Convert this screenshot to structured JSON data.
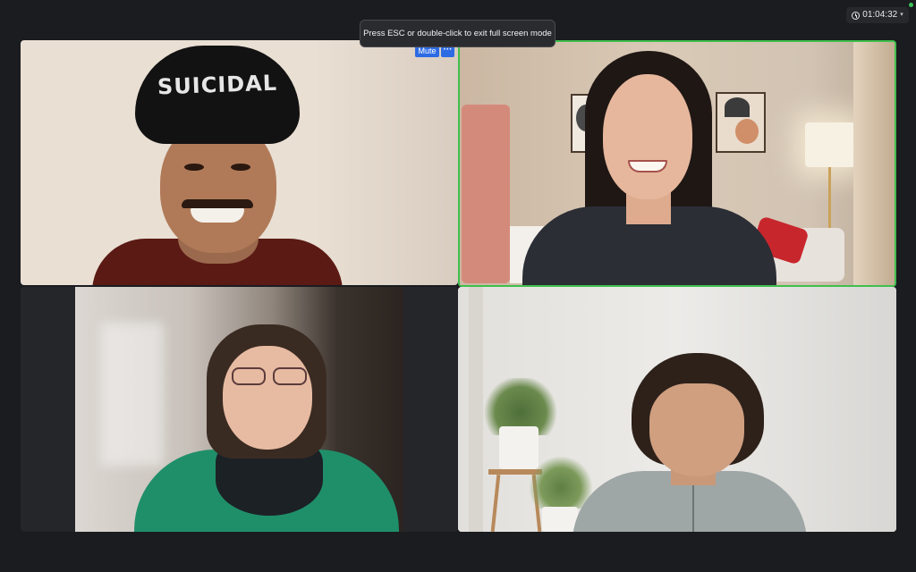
{
  "window": {
    "fullscreen_notice": "Press ESC or double-click to exit full screen mode",
    "meeting_timer": "01:04:32",
    "timer_icon": "clock-icon",
    "timer_dropdown_icon": "chevron-down-icon",
    "status_color": "#3cc15a"
  },
  "tiles": [
    {
      "id": "participant-1",
      "overlay_controls": {
        "mute_label": "Mute",
        "more_label": "···"
      },
      "cap_text": "SUICIDAL"
    },
    {
      "id": "participant-2",
      "active_speaker": true,
      "highlight_color": "#3fbf4c"
    },
    {
      "id": "participant-3"
    },
    {
      "id": "participant-4"
    }
  ],
  "colors": {
    "background": "#1a1c20",
    "control_blue": "#2d6be4",
    "speaker_border": "#3fbf4c"
  }
}
